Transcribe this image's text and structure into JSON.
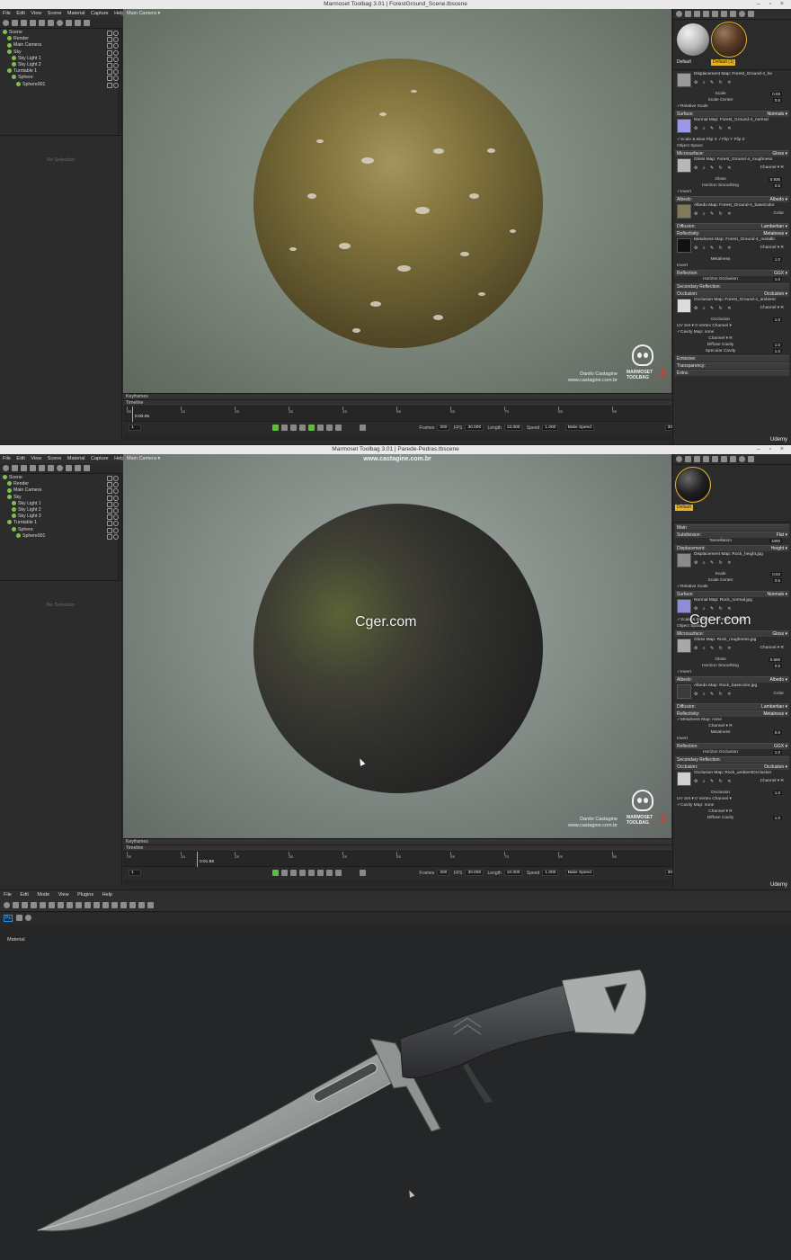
{
  "shot1": {
    "window_title": "Marmoset Toolbag 3.01  |  ForestGround_Scene.tbscene",
    "menu": [
      "File",
      "Edit",
      "View",
      "Scene",
      "Material",
      "Capture",
      "Help"
    ],
    "outliner": [
      {
        "label": "Scene",
        "indent": 0
      },
      {
        "label": "Render",
        "indent": 1
      },
      {
        "label": "Main Camera",
        "indent": 1
      },
      {
        "label": "Sky",
        "indent": 1
      },
      {
        "label": "Sky Light 1",
        "indent": 2
      },
      {
        "label": "Sky Light 2",
        "indent": 2
      },
      {
        "label": "Turntable 1",
        "indent": 1
      },
      {
        "label": "Sphere",
        "indent": 2
      },
      {
        "label": "Sphere001",
        "indent": 3
      }
    ],
    "no_selection": "No Selection",
    "camera_label": "Main Camera ▾",
    "signature": [
      "Danilo Castagine",
      "www.castagine.com.br"
    ],
    "logo_text": [
      "MARMOSET",
      "TOOLBAG"
    ],
    "logo_number": "3",
    "timeline": {
      "keyframes_label": "Keyframes",
      "timeline_label": "Timeline",
      "ticks": [
        "0s",
        "1s",
        "2s",
        "3s",
        "4s",
        "5s",
        "6s",
        "7s",
        "8s",
        "9s"
      ],
      "timecode": "0:00.05",
      "progress": 0.01,
      "frame_field": "1",
      "frames_label": "Frames",
      "frames": "300",
      "fps_label": "FPS",
      "fps": "30.000",
      "length_label": "Length",
      "length": "10.000",
      "speed_label": "Speed",
      "speed": "1.000",
      "bake_speed": "Bake Speed",
      "right_field": "300"
    },
    "swatches": [
      {
        "label": "Default",
        "color": "#bdbdbd"
      },
      {
        "label": "Default (1)",
        "color": "#5a3b26"
      }
    ],
    "material_panel": [
      {
        "kind": "map",
        "title": "Displacement Map: Forest_Ground-4_he",
        "thumb": "#9a9a9a"
      },
      {
        "kind": "row",
        "label": "Scale",
        "value": "0.03"
      },
      {
        "kind": "row",
        "label": "Scale Center",
        "value": "0.5"
      },
      {
        "kind": "check",
        "label": "✓Relative Scale"
      },
      {
        "kind": "sec",
        "label": "Surface:",
        "value": "Normals ▾"
      },
      {
        "kind": "map",
        "title": "Normal Map: Forest_Ground-4_normal",
        "thumb": "#9b98e8"
      },
      {
        "kind": "check",
        "label": "✓Scale & Bias      Flip X      ✓Flip Y      Flip Z"
      },
      {
        "kind": "check",
        "label": "Object Space"
      },
      {
        "kind": "sec",
        "label": "Microsurface:",
        "value": "Gloss ▾"
      },
      {
        "kind": "map",
        "title": "Gloss Map: Forest_Ground-4_roughness",
        "thumb": "#b8b8b8",
        "channel": "Channel ▾ R"
      },
      {
        "kind": "row",
        "label": "Gloss",
        "value": "0.935"
      },
      {
        "kind": "row",
        "label": "Horizon Smoothing",
        "value": "0.5"
      },
      {
        "kind": "check",
        "label": "✓Invert"
      },
      {
        "kind": "sec",
        "label": "Albedo:",
        "value": "Albedo ▾"
      },
      {
        "kind": "map",
        "title": "Albedo Map: Forest_Ground-4_baseColor",
        "thumb": "#7f7a5a",
        "channel": "Color"
      },
      {
        "kind": "sec",
        "label": "Diffusion:",
        "value": "Lambertian ▾"
      },
      {
        "kind": "sec",
        "label": "Reflectivity:",
        "value": "Metalness ▾"
      },
      {
        "kind": "map",
        "title": "Metalness Map: Forest_Ground-4_metallic",
        "thumb": "#111111",
        "channel": "Channel ▾ R"
      },
      {
        "kind": "row",
        "label": "Metalness",
        "value": "1.0"
      },
      {
        "kind": "check",
        "label": "Invert"
      },
      {
        "kind": "sec",
        "label": "Reflection:",
        "value": "GGX ▾"
      },
      {
        "kind": "row",
        "label": "Horizon Occlusion",
        "value": "1.0"
      },
      {
        "kind": "sec",
        "label": "Secondary Reflection:",
        "value": ""
      },
      {
        "kind": "sec",
        "label": "Occlusion:",
        "value": "Occlusion ▾"
      },
      {
        "kind": "map",
        "title": "Occlusion Map: Forest_Ground-4_ambient",
        "thumb": "#dcdcdc",
        "channel": "Channel ▾ R"
      },
      {
        "kind": "row",
        "label": "Occlusion",
        "value": "1.0"
      },
      {
        "kind": "check",
        "label": "UV Set ▾ 0          Vertex Channel ▾"
      },
      {
        "kind": "check",
        "label": "  ✓Cavity Map: none"
      },
      {
        "kind": "row",
        "label": "Channel ▾ R",
        "value": ""
      },
      {
        "kind": "row",
        "label": "Diffuse Cavity",
        "value": "1.0"
      },
      {
        "kind": "row",
        "label": "Specular Cavity",
        "value": "1.0"
      },
      {
        "kind": "sec",
        "label": "Emissive:",
        "value": ""
      },
      {
        "kind": "sec",
        "label": "Transparency:",
        "value": ""
      },
      {
        "kind": "sec",
        "label": "Extra:",
        "value": ""
      }
    ],
    "udemy": "Udemy"
  },
  "shot2": {
    "window_title": "Marmoset Toolbag 3.01  |  Parede-Pedras.tbscene",
    "viewport_watermark": "www.castagine.com.br",
    "menu": [
      "File",
      "Edit",
      "View",
      "Scene",
      "Material",
      "Capture",
      "Help"
    ],
    "outliner": [
      {
        "label": "Scene",
        "indent": 0
      },
      {
        "label": "Render",
        "indent": 1
      },
      {
        "label": "Main Camera",
        "indent": 1
      },
      {
        "label": "Sky",
        "indent": 1
      },
      {
        "label": "Sky Light 1",
        "indent": 2
      },
      {
        "label": "Sky Light 2",
        "indent": 2
      },
      {
        "label": "Sky Light 3",
        "indent": 2
      },
      {
        "label": "Turntable 1",
        "indent": 1
      },
      {
        "label": "Sphere",
        "indent": 2
      },
      {
        "label": "Sphere001",
        "indent": 3
      }
    ],
    "no_selection": "No Selection",
    "camera_label": "Main Camera ▾",
    "signature": [
      "Danilo Castagine",
      "www.castagine.com.br"
    ],
    "logo_text": [
      "MARMOSET",
      "TOOLBAG"
    ],
    "logo_number": "3",
    "cger_watermark": "Cger.com",
    "timeline": {
      "keyframes_label": "Keyframes",
      "timeline_label": "Timeline",
      "ticks": [
        "0s",
        "1s",
        "2s",
        "3s",
        "4s",
        "5s",
        "6s",
        "7s",
        "8s",
        "9s"
      ],
      "timecode": "0:01.88",
      "progress": 0.13,
      "frame_field": "1",
      "frames_label": "Frames",
      "frames": "300",
      "fps_label": "FPS",
      "fps": "30.000",
      "length_label": "Length",
      "length": "10.000",
      "speed_label": "Speed",
      "speed": "1.000",
      "bake_speed": "Bake Speed",
      "right_field": "300"
    },
    "swatches": [
      {
        "label": "Default",
        "color": "#1f1f1f"
      }
    ],
    "material_panel": [
      {
        "kind": "sec",
        "label": "Main",
        "value": ""
      },
      {
        "kind": "sec",
        "label": "Subdivision:",
        "value": "Flat ▾"
      },
      {
        "kind": "row",
        "label": "Tessellation",
        "value": "1000"
      },
      {
        "kind": "sec",
        "label": "Displacement:",
        "value": "Height ▾"
      },
      {
        "kind": "map",
        "title": "Displacement Map: Rock_height.jpg",
        "thumb": "#8a8a8a"
      },
      {
        "kind": "row",
        "label": "Scale",
        "value": "0.04"
      },
      {
        "kind": "row",
        "label": "Scale Center",
        "value": "0.5"
      },
      {
        "kind": "check",
        "label": "✓Relative Scale"
      },
      {
        "kind": "sec",
        "label": "Surface:",
        "value": "Normals ▾"
      },
      {
        "kind": "map",
        "title": "Normal Map: Rock_normal.jpg",
        "thumb": "#8f8cd8"
      },
      {
        "kind": "check",
        "label": "✓Scale & Bias      Flip X      ✓Flip Y      Flip Z"
      },
      {
        "kind": "check",
        "label": "Object Space"
      },
      {
        "kind": "sec",
        "label": "Microsurface:",
        "value": "Gloss ▾"
      },
      {
        "kind": "map",
        "title": "Gloss Map: Rock_roughness.jpg",
        "thumb": "#a8a8a8",
        "channel": "Channel ▾ R"
      },
      {
        "kind": "row",
        "label": "Gloss",
        "value": "0.559"
      },
      {
        "kind": "row",
        "label": "Horizon Smoothing",
        "value": "0.5"
      },
      {
        "kind": "check",
        "label": "✓Invert"
      },
      {
        "kind": "sec",
        "label": "Albedo:",
        "value": "Albedo ▾"
      },
      {
        "kind": "map",
        "title": "Albedo Map: Rock_basecolor.jpg",
        "thumb": "#3a3a36",
        "channel": "Color"
      },
      {
        "kind": "sec",
        "label": "Diffusion:",
        "value": "Lambertian ▾"
      },
      {
        "kind": "sec",
        "label": "Reflectivity:",
        "value": "Metalness ▾"
      },
      {
        "kind": "check",
        "label": "  ✓Metalness Map: none"
      },
      {
        "kind": "row",
        "label": "Channel ▾ R",
        "value": ""
      },
      {
        "kind": "row",
        "label": "Metalness",
        "value": "0.0"
      },
      {
        "kind": "check",
        "label": "Invert"
      },
      {
        "kind": "sec",
        "label": "Reflection:",
        "value": "GGX ▾"
      },
      {
        "kind": "row",
        "label": "Horizon Occlusion",
        "value": "1.0"
      },
      {
        "kind": "sec",
        "label": "Secondary Reflection:",
        "value": ""
      },
      {
        "kind": "sec",
        "label": "Occlusion:",
        "value": "Occlusion ▾"
      },
      {
        "kind": "map",
        "title": "Occlusion Map: Rock_ambientOcclusion",
        "thumb": "#d0d0d0",
        "channel": "Channel ▾ R"
      },
      {
        "kind": "row",
        "label": "Occlusion",
        "value": "1.0"
      },
      {
        "kind": "check",
        "label": "UV Set ▾ 0          Vertex Channel ▾"
      },
      {
        "kind": "check",
        "label": "  ✓Cavity Map: none"
      },
      {
        "kind": "row",
        "label": "Channel ▾ R",
        "value": ""
      },
      {
        "kind": "row",
        "label": "Diffuse Cavity",
        "value": "1.0"
      }
    ],
    "udemy": "Udemy"
  },
  "shot3": {
    "menu": [
      "File",
      "Edit",
      "Mode",
      "View",
      "Plugins",
      "Help"
    ],
    "ps_badge": "Ps",
    "material_label": "Material",
    "background": "#252627"
  }
}
